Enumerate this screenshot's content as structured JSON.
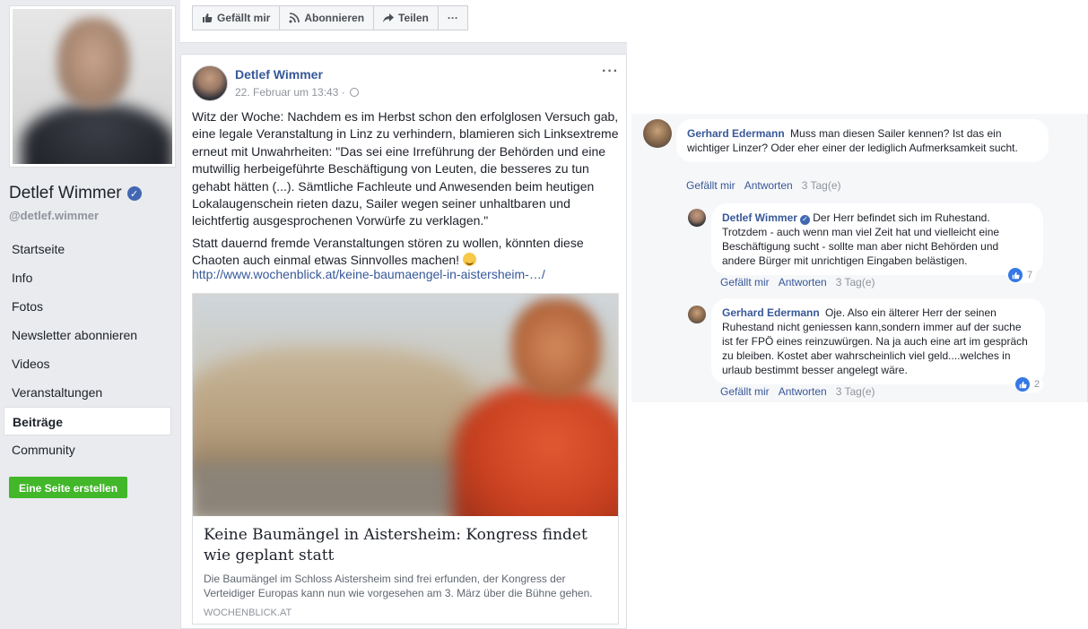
{
  "sidebar": {
    "page_name": "Detlef Wimmer",
    "handle": "@detlef.wimmer",
    "nav": [
      "Startseite",
      "Info",
      "Fotos",
      "Newsletter abonnieren",
      "Videos",
      "Veranstaltungen",
      "Beiträge",
      "Community"
    ],
    "active_nav": "Beiträge",
    "create_button": "Eine Seite erstellen"
  },
  "actionbar": {
    "like": "Gefällt mir",
    "subscribe": "Abonnieren",
    "share": "Teilen",
    "more": "···"
  },
  "post": {
    "author": "Detlef Wimmer",
    "date": "22. Februar um 13:43 ·",
    "more": "···",
    "paragraph1": "Witz der Woche: Nachdem es im Herbst schon den erfolglosen Versuch gab, eine legale Veranstaltung in Linz zu verhindern, blamieren sich Linksextreme erneut mit Unwahrheiten: \"Das sei eine Irreführung der Behörden und eine mutwillig herbeigeführte Beschäftigung von Leuten, die besseres zu tun gehabt hätten (...). Sämtliche Fachleute und Anwesenden beim heutigen Lokalaugenschein rieten dazu, Sailer wegen seiner unhaltbaren und leichtfertig ausgesprochenen Vorwürfe zu verklagen.\"",
    "paragraph2": "Statt dauernd fremde Veranstaltungen stören zu wollen, könnten diese Chaoten auch einmal etwas Sinnvolles machen!",
    "link": "http://www.wochenblick.at/keine-baumaengel-in-aistersheim-…/",
    "card": {
      "title": "Keine Baumängel in Aistersheim: Kongress findet wie geplant statt",
      "description": "Die Baumängel im Schloss Aistersheim sind frei erfunden, der Kongress der Verteidiger Europas kann nun wie vorgesehen am 3. März über die Bühne gehen.",
      "domain": "WOCHENBLICK.AT"
    }
  },
  "comments": [
    {
      "author": "Gerhard Edermann",
      "text": "Muss man diesen Sailer kennen? Ist das ein wichtiger Linzer? Oder eher einer der lediglich Aufmerksamkeit sucht.",
      "like": "Gefällt mir",
      "reply": "Antworten",
      "time": "3 Tag(e)"
    },
    {
      "author": "Detlef Wimmer",
      "verified": true,
      "text": "Der Herr befindet sich im Ruhestand. Trotzdem - auch wenn man viel Zeit hat und vielleicht eine Beschäftigung sucht - sollte man aber nicht Behörden und andere Bürger mit unrichtigen Eingaben belästigen.",
      "reactions": "7",
      "like": "Gefällt mir",
      "reply": "Antworten",
      "time": "3 Tag(e)"
    },
    {
      "author": "Gerhard Edermann",
      "text": "Oje. Also ein älterer Herr der seinen Ruhestand nicht geniessen kann,sondern immer auf der suche ist fer FPÖ eines reinzuwürgen. Na ja auch eine art im gespräch zu bleiben. Kostet aber wahrscheinlich viel geld....welches in urlaub bestimmt besser angelegt wäre.",
      "reactions": "2",
      "like": "Gefällt mir",
      "reply": "Antworten",
      "time": "3 Tag(e)"
    }
  ],
  "colors": {
    "link_blue": "#365899",
    "brand_green": "#42b72a",
    "bg": "#e9ebee",
    "like_blue": "#3578e5"
  }
}
